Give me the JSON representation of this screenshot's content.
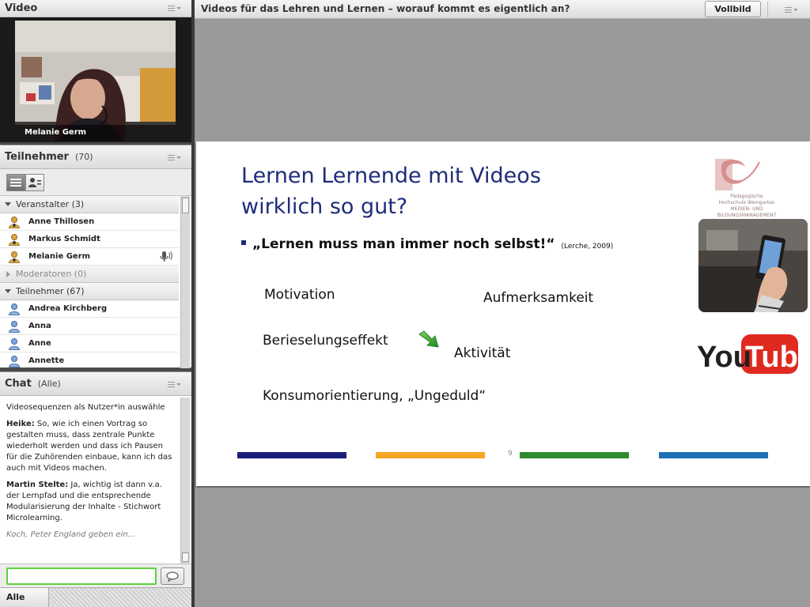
{
  "video_pod": {
    "title": "Video",
    "speaker_name": "Melanie Germ"
  },
  "participants_pod": {
    "title": "Teilnehmer",
    "count": "(70)",
    "groups": [
      {
        "label": "Veranstalter (3)",
        "expanded": true,
        "members": [
          {
            "name": "Anne Thillosen",
            "role": "host",
            "speaking": false
          },
          {
            "name": "Markus Schmidt",
            "role": "host",
            "speaking": false
          },
          {
            "name": "Melanie Germ",
            "role": "host",
            "speaking": true
          }
        ]
      },
      {
        "label": "Moderatoren (0)",
        "expanded": false,
        "members": []
      },
      {
        "label": "Teilnehmer (67)",
        "expanded": true,
        "members": [
          {
            "name": "Andrea Kirchberg",
            "role": "participant",
            "speaking": false
          },
          {
            "name": "Anna",
            "role": "participant",
            "speaking": false
          },
          {
            "name": "Anne",
            "role": "participant",
            "speaking": false
          },
          {
            "name": "Annette",
            "role": "participant",
            "speaking": false
          }
        ]
      }
    ]
  },
  "chat_pod": {
    "title": "Chat",
    "scope": "(Alle)",
    "messages": [
      {
        "author": "",
        "text": "Videosequenzen als Nutzer*in auswähle"
      },
      {
        "author": "Heike:",
        "text": " So, wie ich einen Vortrag so gestalten muss, dass zentrale Punkte wiederholt werden und dass ich Pausen für die Zuhörenden einbaue, kann ich das auch mit Videos machen."
      },
      {
        "author": "Martin Stelte:",
        "text": " Ja, wichtig ist dann v.a. der Lernpfad und die entsprechende Modularisierung der Inhalte - Stichwort Microlearning."
      }
    ],
    "typing_status": "Koch, Peter England geben ein...",
    "input_value": "",
    "recipient": "Alle"
  },
  "share_pod": {
    "title": "Videos für das Lehren und Lernen – worauf kommt es eigentlich an?",
    "fullscreen_label": "Vollbild",
    "slide": {
      "title_line1": "Lernen Lernende mit Videos",
      "title_line2": "wirklich so gut?",
      "bullet": "„Lernen muss man immer noch selbst!“",
      "citation": "(Lerche, 2009)",
      "keywords": {
        "motivation": "Motivation",
        "aufmerksamkeit": "Aufmerksamkeit",
        "berieselung": "Berieselungseffekt",
        "aktivitaet": "Aktivität",
        "konsum": "Konsumorientierung,  „Ungeduld“"
      },
      "logo_text_line1": "Pädagogische",
      "logo_text_line2": "Hochschule Weingarten",
      "logo_text_line3": "MEDIEN- UND",
      "logo_text_line4": "BILDUNGSMANAGEMENT",
      "youtube_you": "You",
      "youtube_tube": "Tube",
      "page_number": "9",
      "bar_colors": [
        "#1a1f7a",
        "#f5a623",
        "#2e8b2e",
        "#1f6fb5"
      ]
    }
  },
  "colors": {
    "slide_title": "#1f2c7a",
    "chat_input_border": "#5bd33a",
    "youtube_red": "#e02a20"
  }
}
